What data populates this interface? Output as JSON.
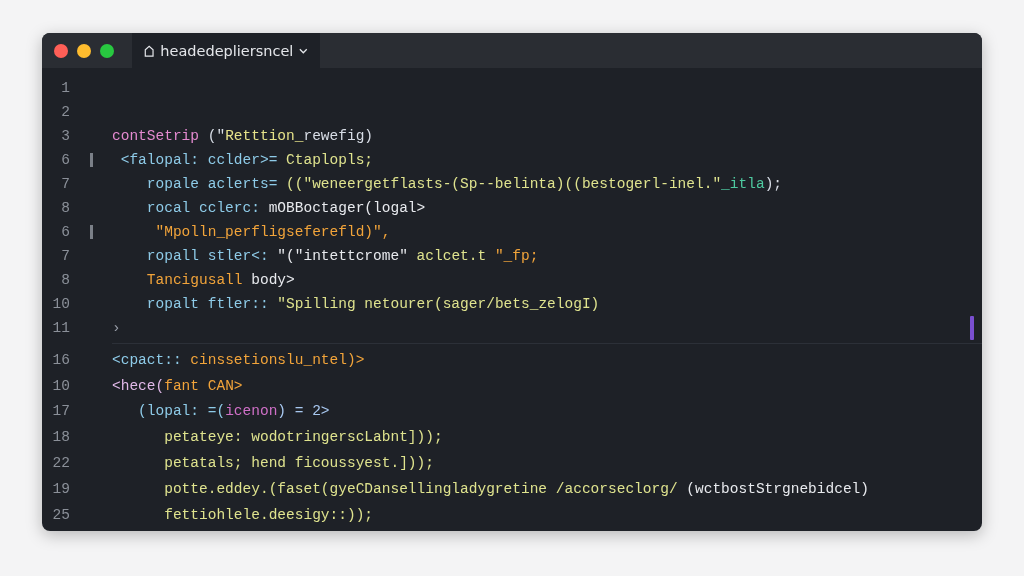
{
  "window": {
    "tab": {
      "title": "headedepliersncel"
    }
  },
  "groups": [
    {
      "lines": [
        {
          "number": "1",
          "marked": false
        },
        {
          "number": "2",
          "marked": false
        },
        {
          "number": "3",
          "marked": false,
          "tokens": [
            {
              "text": "contSetrip",
              "color": "#e48ad0"
            },
            {
              "text": " (\"",
              "color": "#d8dde6"
            },
            {
              "text": "Retttion_",
              "color": "#e6e38a"
            },
            {
              "text": "rewefig)",
              "color": "#d8dde6"
            }
          ]
        },
        {
          "number": "6",
          "marked": true,
          "tokens": [
            {
              "text": " <falopal: cclder>=",
              "color": "#8ecbe8"
            },
            {
              "text": " Ctaplopls;",
              "color": "#dfe38e"
            }
          ]
        },
        {
          "number": "7",
          "marked": false,
          "tokens": [
            {
              "text": "    ropale aclerts=",
              "color": "#8ecbe8"
            },
            {
              "text": " ((\"weneergetflasts-(Sp--belinta)((bestogerl-inel.\"",
              "color": "#dfe38e"
            },
            {
              "text": "_itla",
              "color": "#4ec9a0"
            },
            {
              "text": ");",
              "color": "#d8dde6"
            }
          ]
        },
        {
          "number": "8",
          "marked": false,
          "tokens": [
            {
              "text": "    rocal cclerc:",
              "color": "#8ecbe8"
            },
            {
              "text": " mOBBoctager(logal>",
              "color": "#e8eaee"
            }
          ]
        },
        {
          "number": "6",
          "marked": true,
          "tokens": [
            {
              "text": "     \"Mpolln_perfligseferefld)\",",
              "color": "#f2a43a"
            }
          ]
        },
        {
          "number": "7",
          "marked": false,
          "tokens": [
            {
              "text": "    ropall stler<:",
              "color": "#8ecbe8"
            },
            {
              "text": " \"(\"intettcrome\"",
              "color": "#e8eaee"
            },
            {
              "text": " aclcet.t",
              "color": "#dfe38e"
            },
            {
              "text": " \"_fp;",
              "color": "#f2a43a"
            }
          ]
        },
        {
          "number": "8",
          "marked": false,
          "tokens": [
            {
              "text": "    Tancigusall",
              "color": "#f2a43a"
            },
            {
              "text": " body>",
              "color": "#e8eaee"
            }
          ]
        },
        {
          "number": "10",
          "marked": false,
          "tokens": [
            {
              "text": "    ropalt ftler::",
              "color": "#8ecbe8"
            },
            {
              "text": " \"Spilling netourer(sager/bets_zelogI)",
              "color": "#dfe38e"
            }
          ]
        },
        {
          "number": "11",
          "marked": false,
          "tokens": [
            {
              "text": "›",
              "color": "#9aa0aa"
            }
          ]
        }
      ]
    },
    {
      "lines": [
        {
          "number": "16",
          "marked": false,
          "tokens": [
            {
              "text": "<cpact::",
              "color": "#8ecbe8"
            },
            {
              "text": " cinssetionslu_ntel)>",
              "color": "#f2a43a"
            }
          ]
        },
        {
          "number": "10",
          "marked": false,
          "tokens": [
            {
              "text": "<hece(",
              "color": "#e0b8e8"
            },
            {
              "text": "fant CAN>",
              "color": "#f2a43a"
            }
          ]
        },
        {
          "number": "17",
          "marked": false,
          "tokens": [
            {
              "text": "   (lopal: =(",
              "color": "#8ecbe8"
            },
            {
              "text": "icenon",
              "color": "#d070c8"
            },
            {
              "text": ") = 2>",
              "color": "#a8c8f0"
            }
          ]
        },
        {
          "number": "18",
          "marked": false,
          "tokens": [
            {
              "text": "      petateye: wodotringerscLabnt]));",
              "color": "#dfe38e"
            }
          ]
        },
        {
          "number": "22",
          "marked": false,
          "tokens": [
            {
              "text": "      petatals; hend ficoussyest.]));",
              "color": "#dfe38e"
            }
          ]
        },
        {
          "number": "19",
          "marked": false,
          "tokens": [
            {
              "text": "      potte.eddey.(faset(gyeCDansellingladygretine /accorseclorg/",
              "color": "#dfe38e"
            },
            {
              "text": " (wctbostStrgnebidcel)",
              "color": "#e8eaee"
            }
          ]
        },
        {
          "number": "25",
          "marked": false,
          "tokens": [
            {
              "text": "      fettiohlele.deesigy::));",
              "color": "#dfe38e"
            }
          ]
        }
      ]
    }
  ]
}
